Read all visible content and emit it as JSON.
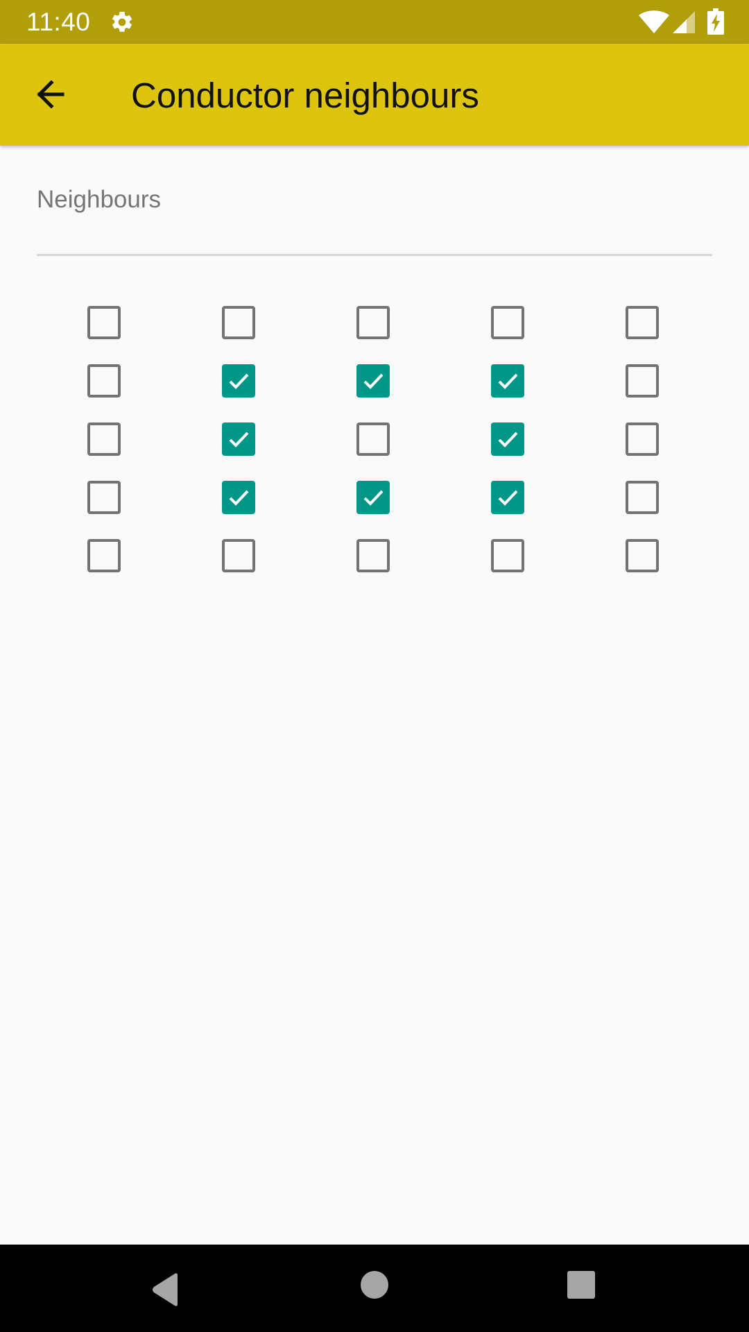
{
  "status_bar": {
    "time": "11:40",
    "icons": [
      "gear-icon",
      "wifi-icon",
      "cell-signal-icon",
      "battery-charging-icon"
    ]
  },
  "app_bar": {
    "title": "Conductor neighbours",
    "back_icon": "arrow-back-icon",
    "color": "#dcc40f"
  },
  "field": {
    "label": "Neighbours"
  },
  "checkbox_grid": {
    "rows": 5,
    "columns": 5,
    "checked": [
      [
        false,
        false,
        false,
        false,
        false
      ],
      [
        false,
        true,
        true,
        true,
        false
      ],
      [
        false,
        true,
        false,
        true,
        false
      ],
      [
        false,
        true,
        true,
        true,
        false
      ],
      [
        false,
        false,
        false,
        false,
        false
      ]
    ],
    "checked_color": "#009688",
    "unchecked_color": "#737373"
  },
  "nav_bar": {
    "buttons": [
      "nav-back-icon",
      "nav-home-icon",
      "nav-recents-icon"
    ]
  },
  "colors": {
    "status_bar": "#b09e0a",
    "background": "#fafafa"
  }
}
